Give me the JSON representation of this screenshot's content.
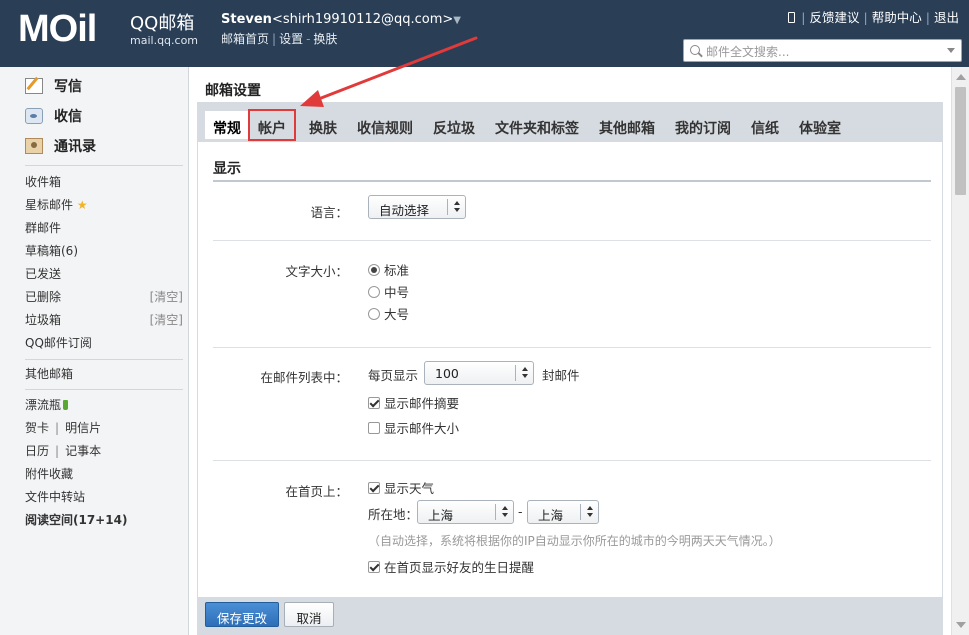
{
  "header": {
    "logo_main": "MOil",
    "logo_brand": "QQ邮箱",
    "logo_domain": "mail.qq.com",
    "user_name": "Steven",
    "user_email": "<shirh19910112@qq.com>",
    "user_caret": "▼",
    "nav": [
      "邮箱首页",
      "设置",
      "换肤"
    ],
    "nav_sep": [
      "|",
      "-"
    ],
    "top_links": [
      "反馈建议",
      "帮助中心",
      "退出"
    ],
    "search_placeholder": "邮件全文搜索..."
  },
  "sidebar": {
    "actions": [
      {
        "label": "写信",
        "icon": "write-icon"
      },
      {
        "label": "收信",
        "icon": "inbox-icon"
      },
      {
        "label": "通讯录",
        "icon": "contacts-icon"
      }
    ],
    "folders": [
      {
        "label": "收件箱"
      },
      {
        "label": "星标邮件",
        "star": "★"
      },
      {
        "label": "群邮件"
      },
      {
        "label": "草稿箱(6)"
      },
      {
        "label": "已发送"
      },
      {
        "label": "已删除",
        "extra": "[清空]"
      },
      {
        "label": "垃圾箱",
        "extra": "[清空]"
      },
      {
        "label": "QQ邮件订阅"
      }
    ],
    "other_mail": "其他邮箱",
    "apps": {
      "drift": "漂流瓶",
      "card": "贺卡",
      "postcard": "明信片",
      "calendar": "日历",
      "notes": "记事本",
      "attachments": "附件收藏",
      "transfer": "文件中转站",
      "reading": "阅读空间(17+14)",
      "sep": "|"
    }
  },
  "main": {
    "title": "邮箱设置",
    "tabs": [
      "常规",
      "帐户",
      "换肤",
      "收信规则",
      "反垃圾",
      "文件夹和标签",
      "其他邮箱",
      "我的订阅",
      "信纸",
      "体验室"
    ],
    "section_title": "显示",
    "language": {
      "label": "语言：",
      "value": "自动选择"
    },
    "font_size": {
      "label": "文字大小：",
      "options": [
        "标准",
        "中号",
        "大号"
      ],
      "selected": "标准"
    },
    "mail_list": {
      "label": "在邮件列表中：",
      "per_page_prefix": "每页显示",
      "per_page_value": "100",
      "per_page_suffix": "封邮件",
      "show_summary": "显示邮件摘要",
      "show_size": "显示邮件大小"
    },
    "home": {
      "label": "在首页上：",
      "show_weather": "显示天气",
      "location_label": "所在地：",
      "province": "上海",
      "dash": "-",
      "city": "上海",
      "hint": "（自动选择，系统将根据你的IP自动显示你所在的城市的今明两天天气情况。）",
      "birthday": "在首页显示好友的生日提醒"
    },
    "save_button": "保存更改",
    "cancel_button": "取消"
  },
  "colors": {
    "header_bg": "#2a3e56",
    "primary_button": "#2e6fb8",
    "annotation": "#e13a3a"
  }
}
